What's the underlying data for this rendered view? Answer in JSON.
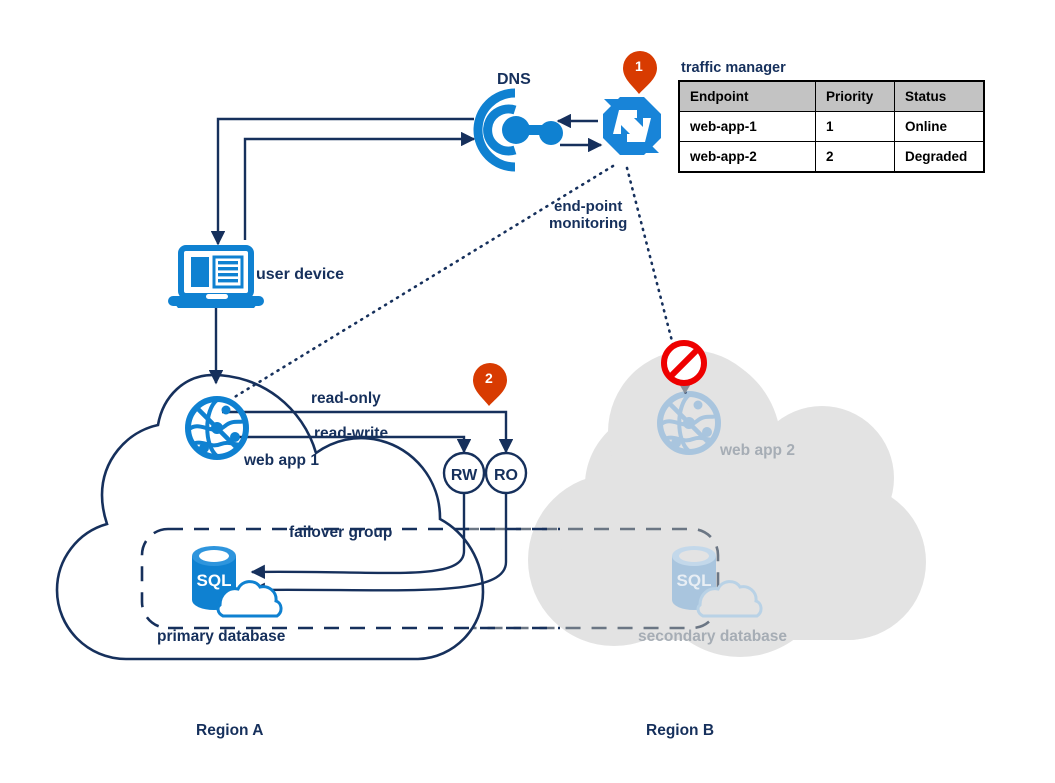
{
  "diagram": {
    "title": "Azure multi-region web app failover architecture",
    "colors": {
      "azure_blue": "#0f81d1",
      "dark_navy": "#16305c",
      "orange_pin": "#d83b01",
      "grey_region": "#e3e3e3",
      "grey_icon": "#a9c5de",
      "grey_text": "#a6adb5",
      "status_online": "#00b033",
      "status_degraded": "#d50000",
      "table_header": "#c3c3c3",
      "no_entry_red": "#ee0000"
    }
  },
  "traffic_manager": {
    "title": "traffic manager",
    "columns": [
      "Endpoint",
      "Priority",
      "Status"
    ],
    "rows": [
      {
        "endpoint": "web-app-1",
        "priority": "1",
        "status": "Online"
      },
      {
        "endpoint": "web-app-2",
        "priority": "2",
        "status": "Degraded"
      }
    ]
  },
  "labels": {
    "dns": "DNS",
    "user_device": "user device",
    "endpoint_monitoring_line1": "end-point",
    "endpoint_monitoring_line2": "monitoring",
    "read_only": "read-only",
    "read_write": "read-write",
    "web_app_1": "web app 1",
    "web_app_2": "web app 2",
    "failover_group": "failover group",
    "primary_database": "primary database",
    "secondary_database": "secondary database",
    "region_a": "Region A",
    "region_b": "Region B",
    "rw": "RW",
    "ro": "RO",
    "sql_primary": "SQL",
    "sql_secondary": "SQL"
  },
  "markers": {
    "pin_1": "1",
    "pin_2": "2"
  }
}
